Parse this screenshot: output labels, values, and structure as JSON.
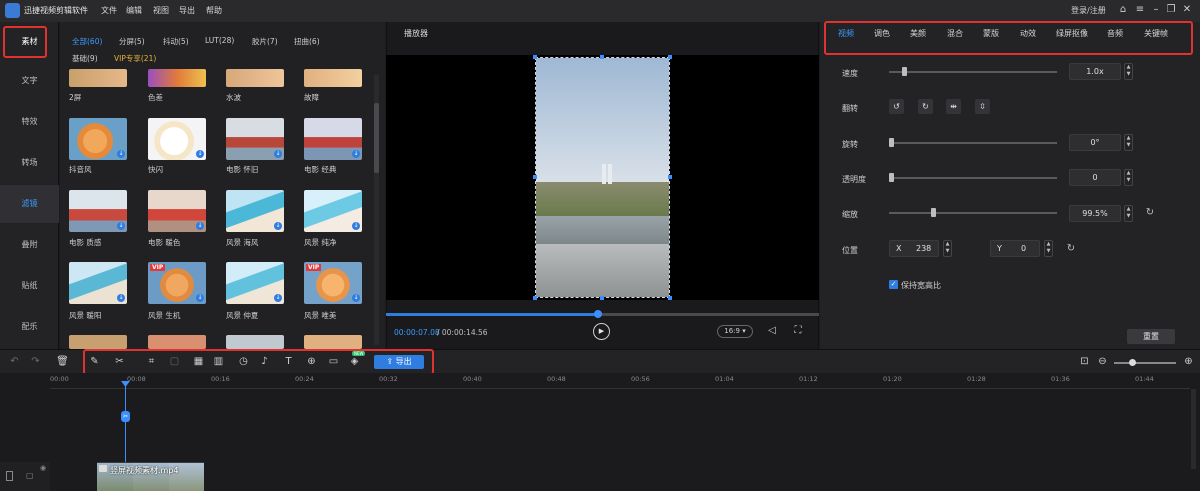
{
  "app": {
    "title": "迅捷视频剪辑软件"
  },
  "menu": [
    "文件",
    "编辑",
    "视图",
    "导出",
    "帮助"
  ],
  "login": "登录/注册",
  "leftnav": [
    "素材",
    "文字",
    "特效",
    "转场",
    "滤镜",
    "叠附",
    "贴纸",
    "配乐"
  ],
  "library": {
    "categories": [
      "全部(60)",
      "分屏(5)",
      "抖动(5)",
      "LUT(28)",
      "胶片(7)",
      "扭曲(6)",
      "基础(9)",
      "VIP专享(21)"
    ],
    "rows": [
      [
        "2屏",
        "色差",
        "水波",
        "故障"
      ],
      [
        "抖音风",
        "快闪",
        "电影 怀旧",
        "电影 经典"
      ],
      [
        "电影 质感",
        "电影 暖色",
        "风景 海风",
        "风景 纯净"
      ],
      [
        "风景 暖阳",
        "风景 生机",
        "风景 仲夏",
        "风景 唯美"
      ]
    ],
    "vip_badge": "VIP"
  },
  "player": {
    "title": "播放器",
    "current_time": "00:00:07.08",
    "total_time": "/ 00:00:14.56",
    "aspect": "16:9",
    "progress": 0.49
  },
  "props": {
    "tabs": [
      "视频",
      "调色",
      "美颜",
      "混合",
      "蒙版",
      "动效",
      "绿屏抠像",
      "音频",
      "关键帧"
    ],
    "speed_label": "速度",
    "speed_value": "1.0x",
    "speed_level": 0.08,
    "flip_label": "翻转",
    "rotate_label": "旋转",
    "rotate_value": "0°",
    "rotate_level": 0.0,
    "opacity_label": "透明度",
    "opacity_value": "0",
    "opacity_level": 0.0,
    "scale_label": "缩放",
    "scale_value": "99.5%",
    "scale_level": 0.25,
    "position_label": "位置",
    "pos_x_label": "X",
    "pos_x_value": "238",
    "pos_y_label": "Y",
    "pos_y_value": "0",
    "keep_ratio": "保持宽高比",
    "reset": "重置"
  },
  "toolbar": {
    "export": "导出",
    "new_badge": "NEW"
  },
  "timeline": {
    "ticks": [
      "00:00",
      "00:08",
      "00:16",
      "00:24",
      "00:32",
      "00:40",
      "00:48",
      "00:56",
      "01:04",
      "01:12",
      "01:20",
      "01:28",
      "01:36",
      "01:44"
    ],
    "clip_name": "竖屏视频素材.mp4"
  },
  "colors": {
    "accent": "#2f7de0",
    "highlight": "#e0322f"
  }
}
